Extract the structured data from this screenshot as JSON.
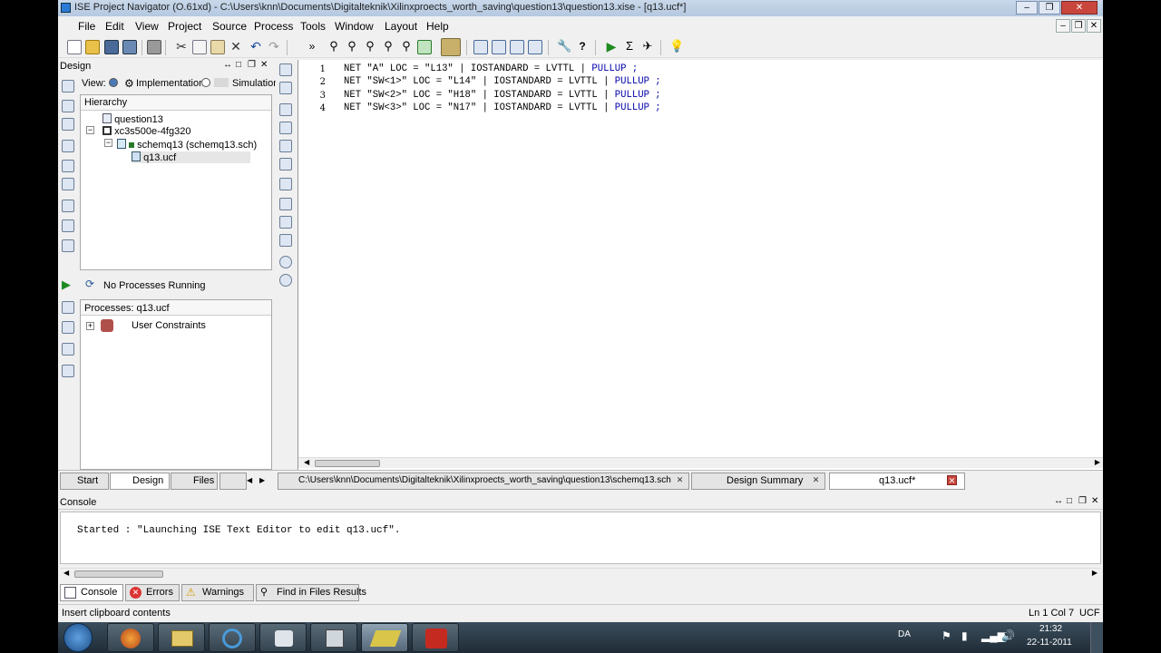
{
  "window": {
    "title": "ISE Project Navigator (O.61xd) - C:\\Users\\knn\\Documents\\Digitalteknik\\Xilinxproects_worth_saving\\question13\\question13.xise - [q13.ucf*]"
  },
  "menu": [
    "File",
    "Edit",
    "View",
    "Project",
    "Source",
    "Process",
    "Tools",
    "Window",
    "Layout",
    "Help"
  ],
  "design": {
    "panel_title": "Design",
    "view_label": "View:",
    "view_options": [
      "Implementation",
      "Simulation"
    ],
    "hierarchy_header": "Hierarchy",
    "tree": [
      "question13",
      "xc3s500e-4fg320",
      "schemq13 (schemq13.sch)",
      "q13.ucf"
    ]
  },
  "processes": {
    "status": "No Processes Running",
    "header": "Processes: q13.ucf",
    "items": [
      "User Constraints"
    ]
  },
  "editor": {
    "lines": [
      {
        "n": "1",
        "a": "NET \"A\" LOC = \"L13\" | IOSTANDARD = LVTTL | ",
        "b": "PULLUP ;"
      },
      {
        "n": "2",
        "a": "NET \"SW<1>\" LOC = \"L14\" | IOSTANDARD = LVTTL | ",
        "b": "PULLUP ;"
      },
      {
        "n": "3",
        "a": "NET \"SW<2>\" LOC = \"H18\" | IOSTANDARD = LVTTL | ",
        "b": "PULLUP ;"
      },
      {
        "n": "4",
        "a": "NET \"SW<3>\" LOC = \"N17\" | IOSTANDARD = LVTTL | ",
        "b": "PULLUP ;"
      }
    ]
  },
  "left_tabs": [
    "Start",
    "Design",
    "Files"
  ],
  "doc_tabs": [
    {
      "label": "C:\\Users\\knn\\Documents\\Digitalteknik\\Xilinxproects_worth_saving\\question13\\schemq13.sch"
    },
    {
      "label": "Design Summary"
    },
    {
      "label": "q13.ucf*"
    }
  ],
  "console": {
    "title": "Console",
    "text": "Started : \"Launching ISE Text Editor to edit q13.ucf\"."
  },
  "console_tabs": [
    "Console",
    "Errors",
    "Warnings",
    "Find in Files Results"
  ],
  "status": {
    "left": "Insert clipboard contents",
    "pos": "Ln 1 Col 7",
    "type": "UCF"
  },
  "tray": {
    "lang": "DA",
    "time": "21:32",
    "date": "22-11-2011"
  },
  "colors": {
    "accent": "#0000aa",
    "close": "#c9463d",
    "taskbar": "#2b3a47"
  }
}
